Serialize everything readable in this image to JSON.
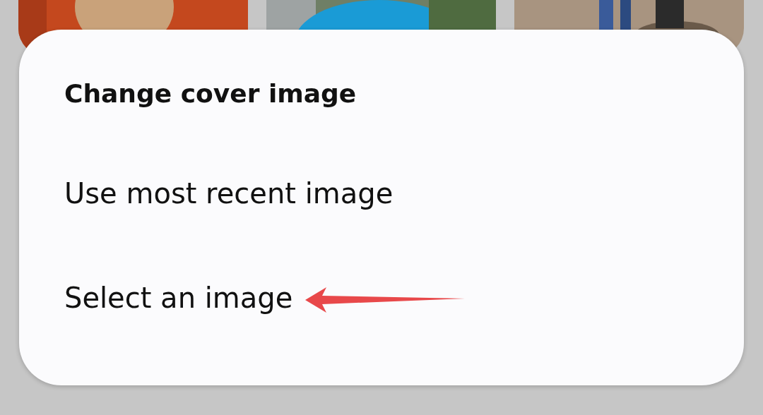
{
  "dialog": {
    "title": "Change cover image",
    "options": [
      "Use most recent image",
      "Select an image"
    ]
  }
}
